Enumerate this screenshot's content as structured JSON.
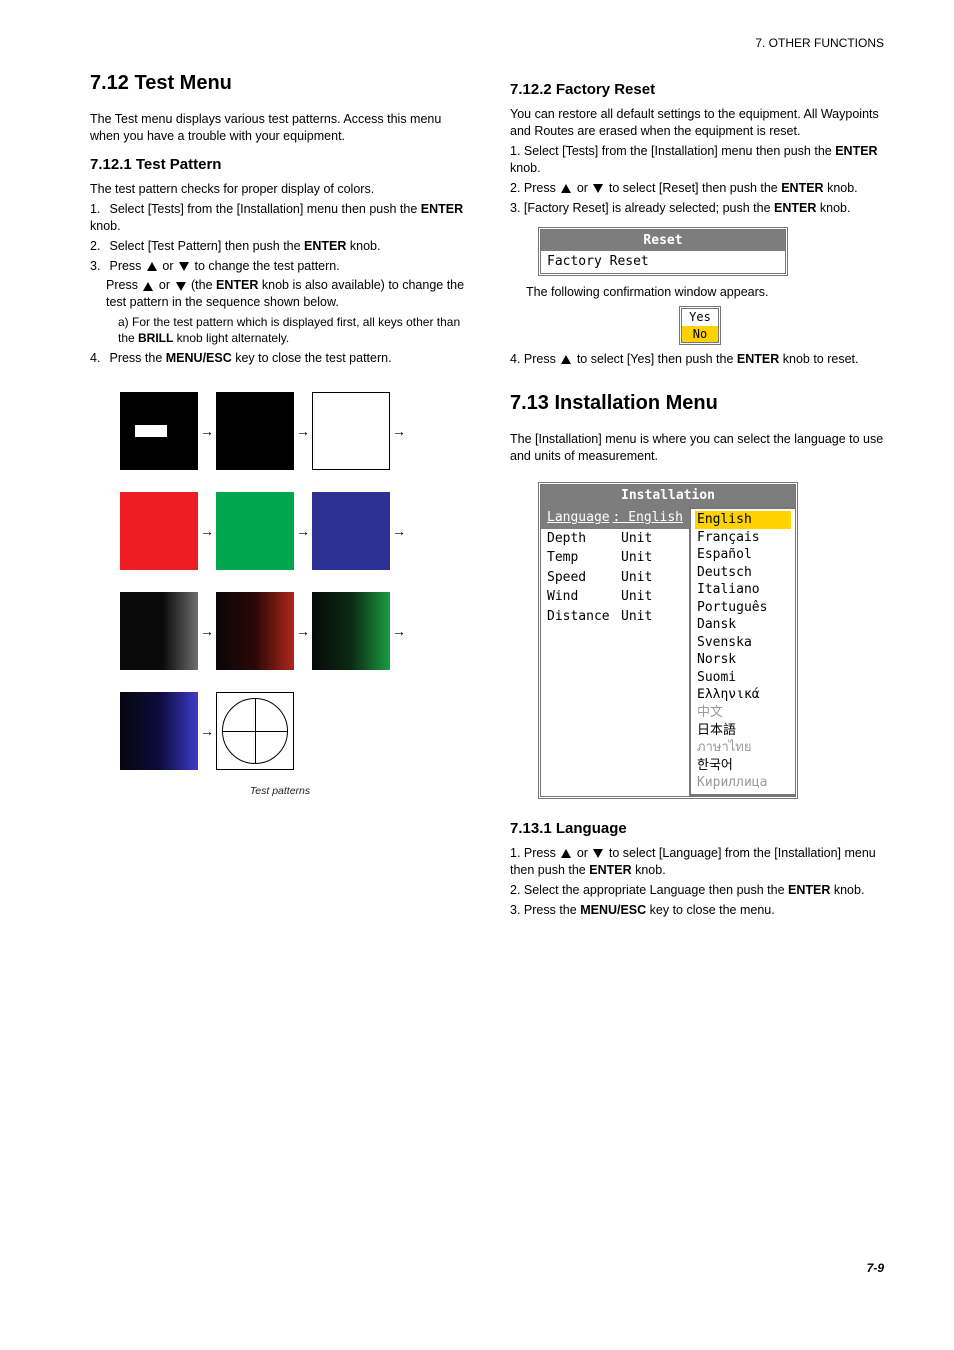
{
  "page_number": "7-9",
  "left": {
    "h1": "7.12 Test Menu",
    "intro": "The Test menu displays various test patterns. Access this menu when you have a trouble with your equipment.",
    "section1_title": "7.12.1 Test Pattern",
    "section1_body": "The test pattern checks for proper display of colors.",
    "steps": [
      "Select [Tests] from the [Installation] menu then push the ENTER knob.",
      "Select [Test Pattern] then push the ENTER knob.",
      "Press  or  to change the test pattern.",
      "Press  or  (the ENTER knob is also available) to change the test pattern in the sequence shown below. ",
      "Press the MENU/ESC key to close the test pattern."
    ],
    "step3_pre": "Press ",
    "step3_post": " to change the test pattern.",
    "step4_pre": "Press ",
    "step4_mid": " (the ",
    "step4_enter": "ENTER",
    "step4_post": " knob is also available) to change the test pattern in the sequence shown below. ",
    "note_a": "a) For the test pattern which is displayed first, all keys other than the ",
    "note_b": " knob light alternately.",
    "note_key": "BRILL",
    "close_pre": "4. Press the ",
    "close_key": "MENU/ESC",
    "close_post": " key to close the test pattern.",
    "enter_label": "ENTER",
    "fig_caption": "Test patterns",
    "installation_word": "Installation",
    "steps_nums": [
      "1.",
      "2.",
      "3.",
      "4."
    ]
  },
  "right": {
    "sec1_title": "7.12.2 Factory Reset",
    "sec1_body": "You can restore all default settings to the equipment. All Waypoints and Routes are erased when the equipment is reset.",
    "reset_steps_1_pre": "1. Select [Tests] from the [",
    "reset_steps_1_post": "] menu then push the ",
    "installation_word": "Installation",
    "enter_label": "ENTER",
    "knob": " knob.",
    "reset_step2_pre": "2. Press ",
    "reset_step2_post": " to select [Reset] then push the ",
    "reset_step3_pre": "3. [Factory Reset] is already selected; push the ",
    "reset_box_title": "Reset",
    "reset_box_item": "Factory Reset",
    "reset_confirm_text": "The following confirmation window appears.",
    "yes": "Yes",
    "no": "No",
    "reset_step4_pre": "4. Press ",
    "reset_step4_mid": " to select [Yes] then push the ",
    "reset_step4_post": " knob to reset.",
    "sec_install_title": "7.13 Installation Menu",
    "install_intro_a": "The ",
    "install_intro_b": " menu is where you can select the language to use and units of measurement.",
    "install_panel_title": "Installation",
    "lang_row_key": "Language",
    "lang_row_val": ": English",
    "settings": [
      {
        "k": "Depth",
        "v": "Unit"
      },
      {
        "k": "Temp",
        "v": "Unit"
      },
      {
        "k": "Speed",
        "v": "Unit"
      },
      {
        "k": "Wind",
        "v": "Unit"
      },
      {
        "k": "Distance",
        "v": "Unit"
      }
    ],
    "languages": [
      {
        "t": "English",
        "hl": true
      },
      {
        "t": "Français"
      },
      {
        "t": "Español"
      },
      {
        "t": "Deutsch"
      },
      {
        "t": "Italiano"
      },
      {
        "t": "Português"
      },
      {
        "t": "Dansk"
      },
      {
        "t": "Svenska"
      },
      {
        "t": "Norsk"
      },
      {
        "t": "Suomi"
      },
      {
        "t": "Ελληνικά"
      },
      {
        "t": "中文",
        "gray": true
      },
      {
        "t": "日本語"
      },
      {
        "t": "ภาษาไทย",
        "gray": true
      },
      {
        "t": "한국어"
      },
      {
        "t": "Кириллица",
        "gray": true
      }
    ],
    "lang_section_title": "7.13.1 Language",
    "lang_steps_1_pre": "1. Press ",
    "lang_steps_1_mid": " to select [Language] from the ",
    "lang_steps_1_post": " menu then push the ",
    "lang_step2": "2. Select the appropriate Language then push the ",
    "lang_step3_pre": "3. Press the ",
    "lang_step3_key": "MENU/ESC",
    "lang_step3_post": " key to close the menu.",
    "or_word": " or "
  },
  "header_right": "7. OTHER FUNCTIONS"
}
